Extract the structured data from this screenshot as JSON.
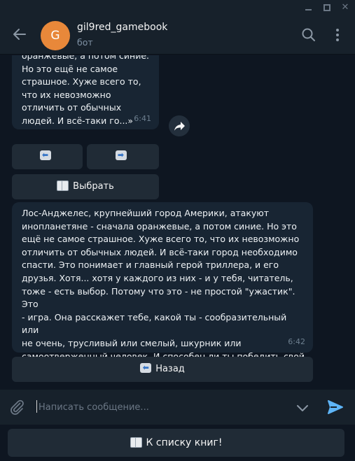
{
  "window": {
    "controls": [
      "minimize",
      "maximize",
      "close"
    ]
  },
  "header": {
    "avatar_letter": "G",
    "avatar_color": "#e8883a",
    "title": "gil9red_gamebook",
    "subtitle": "бот",
    "icons": [
      "back-arrow-icon",
      "search-icon",
      "more-vertical-icon"
    ]
  },
  "messages": [
    {
      "text": "оранжевые, а потом синие.\nНо это ещё не самое\nстрашное. Хуже всего то,\nчто их невозможно\nотличить от обычных\nлюдей. И всё-таки го...»",
      "time": "6:41"
    },
    {
      "text": "Лос-Анджелес, крупнейший город Америки, атакуют\nинопланетяне - сначала оранжевые, а потом синие. Но это\nещё не самое страшное. Хуже всего то, что их невозможно\nотличить от обычных людей. И всё-таки город необходимо\nспасти. Это понимает и главный герой триллера, и его\nдрузья. Хотя... хотя у каждого из них - и у тебя, читатель,\nтоже - есть выбор. Потому что это - не простой \"ужастик\". Это\n- игра. Она расскажет тебе, какой ты - сообразительный или\nне очень, трусливый или смелый, шкурник или\nсамоотверженный человек. И способен ли ты победить свой\nстрах",
      "time": "6:42"
    }
  ],
  "inline_keyboard_1": {
    "left_arrow": "⬅",
    "right_arrow": "➡",
    "select_label": "Выбрать"
  },
  "inline_keyboard_2": {
    "back_arrow": "⬅",
    "back_label": "Назад"
  },
  "composer": {
    "placeholder": "Написать сообщение..."
  },
  "reply_keyboard": {
    "books_label": "К списку книг!"
  },
  "colors": {
    "background": "#0e1621",
    "header": "#17212b",
    "bubble": "#182533",
    "button": "#202b36",
    "accent": "#5eb5f7"
  }
}
